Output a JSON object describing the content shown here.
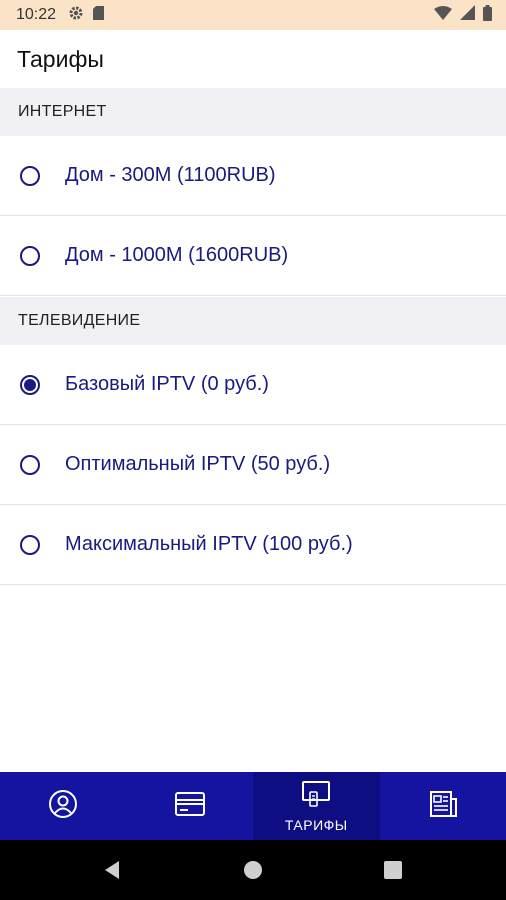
{
  "status_bar": {
    "time": "10:22",
    "icons": [
      "gear-icon",
      "sd-card-icon",
      "wifi-icon",
      "signal-icon",
      "battery-icon"
    ]
  },
  "app_bar": {
    "title": "Тарифы"
  },
  "sections": [
    {
      "header": "ИНТЕРНЕТ",
      "options": [
        {
          "label": "Дом - 300М (1100RUB)",
          "selected": false
        },
        {
          "label": "Дом - 1000М (1600RUB)",
          "selected": false
        }
      ]
    },
    {
      "header": "ТЕЛЕВИДЕНИЕ",
      "options": [
        {
          "label": "Базовый IPTV (0 руб.)",
          "selected": true
        },
        {
          "label": "Оптимальный IPTV (50 руб.)",
          "selected": false
        },
        {
          "label": "Максимальный IPTV (100 руб.)",
          "selected": false
        }
      ]
    }
  ],
  "bottom_nav": {
    "items": [
      {
        "icon": "account-icon",
        "label": "",
        "active": false
      },
      {
        "icon": "payment-card-icon",
        "label": "",
        "active": false
      },
      {
        "icon": "tv-icon",
        "label": "ТАРИФЫ",
        "active": true
      },
      {
        "icon": "news-icon",
        "label": "",
        "active": false
      }
    ]
  },
  "colors": {
    "status_bar": "#fbe3c8",
    "accent": "#1a1a80",
    "nav_bg": "#1414a0",
    "nav_active": "#0e0e82",
    "section_bg": "#f1f1f5"
  }
}
